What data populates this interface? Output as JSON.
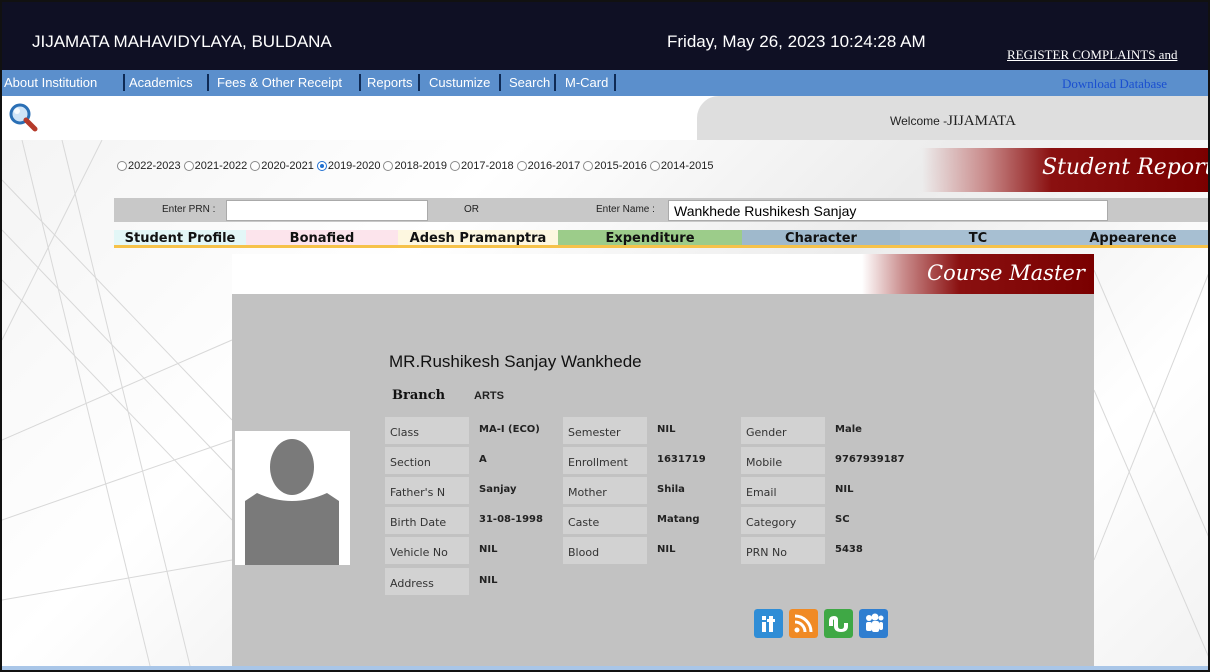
{
  "header": {
    "institution": "JIJAMATA MAHAVIDYLAYA, BULDANA",
    "datetime": "Friday, May 26, 2023 10:24:28 AM",
    "complaints_link": "REGISTER COMPLAINTS and"
  },
  "menu": {
    "items": [
      "About Institution",
      "Academics",
      "Fees & Other Receipt",
      "Reports",
      "Custumize",
      "Search",
      "M-Card"
    ],
    "download": "Download Database"
  },
  "welcome": {
    "prefix": "Welcome -",
    "user": "JIJAMATA"
  },
  "sessions": {
    "options": [
      "2022-2023",
      "2021-2022",
      "2020-2021",
      "2019-2020",
      "2018-2019",
      "2017-2018",
      "2016-2017",
      "2015-2016",
      "2014-2015"
    ],
    "selected": "2019-2020"
  },
  "banner": {
    "student_report": "Student Report",
    "course_master": "Course Master"
  },
  "search": {
    "prn_label": "Enter PRN :",
    "prn_value": "",
    "or_label": "OR",
    "name_label": "Enter Name :",
    "name_value": "Wankhede Rushikesh Sanjay"
  },
  "tabs": [
    {
      "label": "Student Profile",
      "color": "#e3f7f7"
    },
    {
      "label": "Bonafied",
      "color": "#fce4ec"
    },
    {
      "label": "Adesh Pramanptra",
      "color": "#fdf7e0"
    },
    {
      "label": "Expenditure",
      "color": "#9ccc8a"
    },
    {
      "label": "Character",
      "color": "#9fb9cc"
    },
    {
      "label": "TC",
      "color": "#a7bfd2"
    },
    {
      "label": "Appearence",
      "color": "#a7bfd2"
    }
  ],
  "student": {
    "name": "MR.Rushikesh Sanjay Wankhede",
    "branch_label": "Branch",
    "branch": "ARTS",
    "fields": {
      "class": {
        "label": "Class",
        "value": "MA-I (ECO)"
      },
      "semester": {
        "label": "Semester",
        "value": "NIL"
      },
      "gender": {
        "label": "Gender",
        "value": "Male"
      },
      "section": {
        "label": "Section",
        "value": "A"
      },
      "enrollment": {
        "label": "Enrollment",
        "value": "1631719"
      },
      "mobile": {
        "label": "Mobile",
        "value": "9767939187"
      },
      "father": {
        "label": "Father's N",
        "value": "Sanjay"
      },
      "mother": {
        "label": "Mother",
        "value": "Shila"
      },
      "email": {
        "label": "Email",
        "value": "NIL"
      },
      "birth": {
        "label": "Birth Date",
        "value": "31-08-1998"
      },
      "caste": {
        "label": "Caste",
        "value": "Matang"
      },
      "category": {
        "label": "Category",
        "value": "SC"
      },
      "vehicle": {
        "label": "Vehicle No",
        "value": "NIL"
      },
      "blood": {
        "label": "Blood",
        "value": "NIL"
      },
      "prn": {
        "label": "PRN No",
        "value": "5438"
      },
      "address": {
        "label": "Address",
        "value": "NIL"
      }
    }
  },
  "social_icons": [
    "info-icon",
    "rss-icon",
    "stumbleupon-icon",
    "myspace-icon"
  ],
  "colors": {
    "header_bg": "#0f1024",
    "menu_bg": "#5b8fcc",
    "banner_red": "#7a0000",
    "panel_grey": "#c2c2c2"
  }
}
